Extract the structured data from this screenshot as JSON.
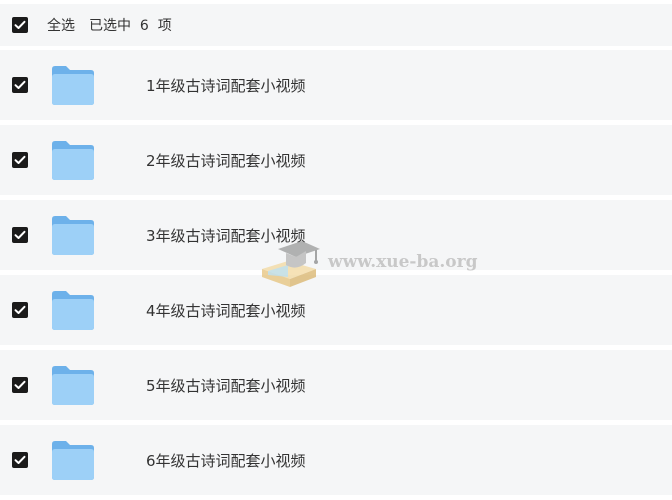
{
  "header": {
    "select_all_label": "全选",
    "selected_text": "已选中  6  项",
    "checked": true
  },
  "files": [
    {
      "name": "1年级古诗词配套小视频",
      "checked": true,
      "icon": "folder-icon"
    },
    {
      "name": "2年级古诗词配套小视频",
      "checked": true,
      "icon": "folder-icon"
    },
    {
      "name": "3年级古诗词配套小视频",
      "checked": true,
      "icon": "folder-icon"
    },
    {
      "name": "4年级古诗词配套小视频",
      "checked": true,
      "icon": "folder-icon"
    },
    {
      "name": "5年级古诗词配套小视频",
      "checked": true,
      "icon": "folder-icon"
    },
    {
      "name": "6年级古诗词配套小视频",
      "checked": true,
      "icon": "folder-icon"
    }
  ],
  "watermark": {
    "text": "www.xue-ba.org"
  },
  "colors": {
    "row_background": "#f5f6f7",
    "checkbox": "#1b1b1b",
    "folder_light": "#9dd0f7",
    "folder_dark": "#6db1ea"
  }
}
